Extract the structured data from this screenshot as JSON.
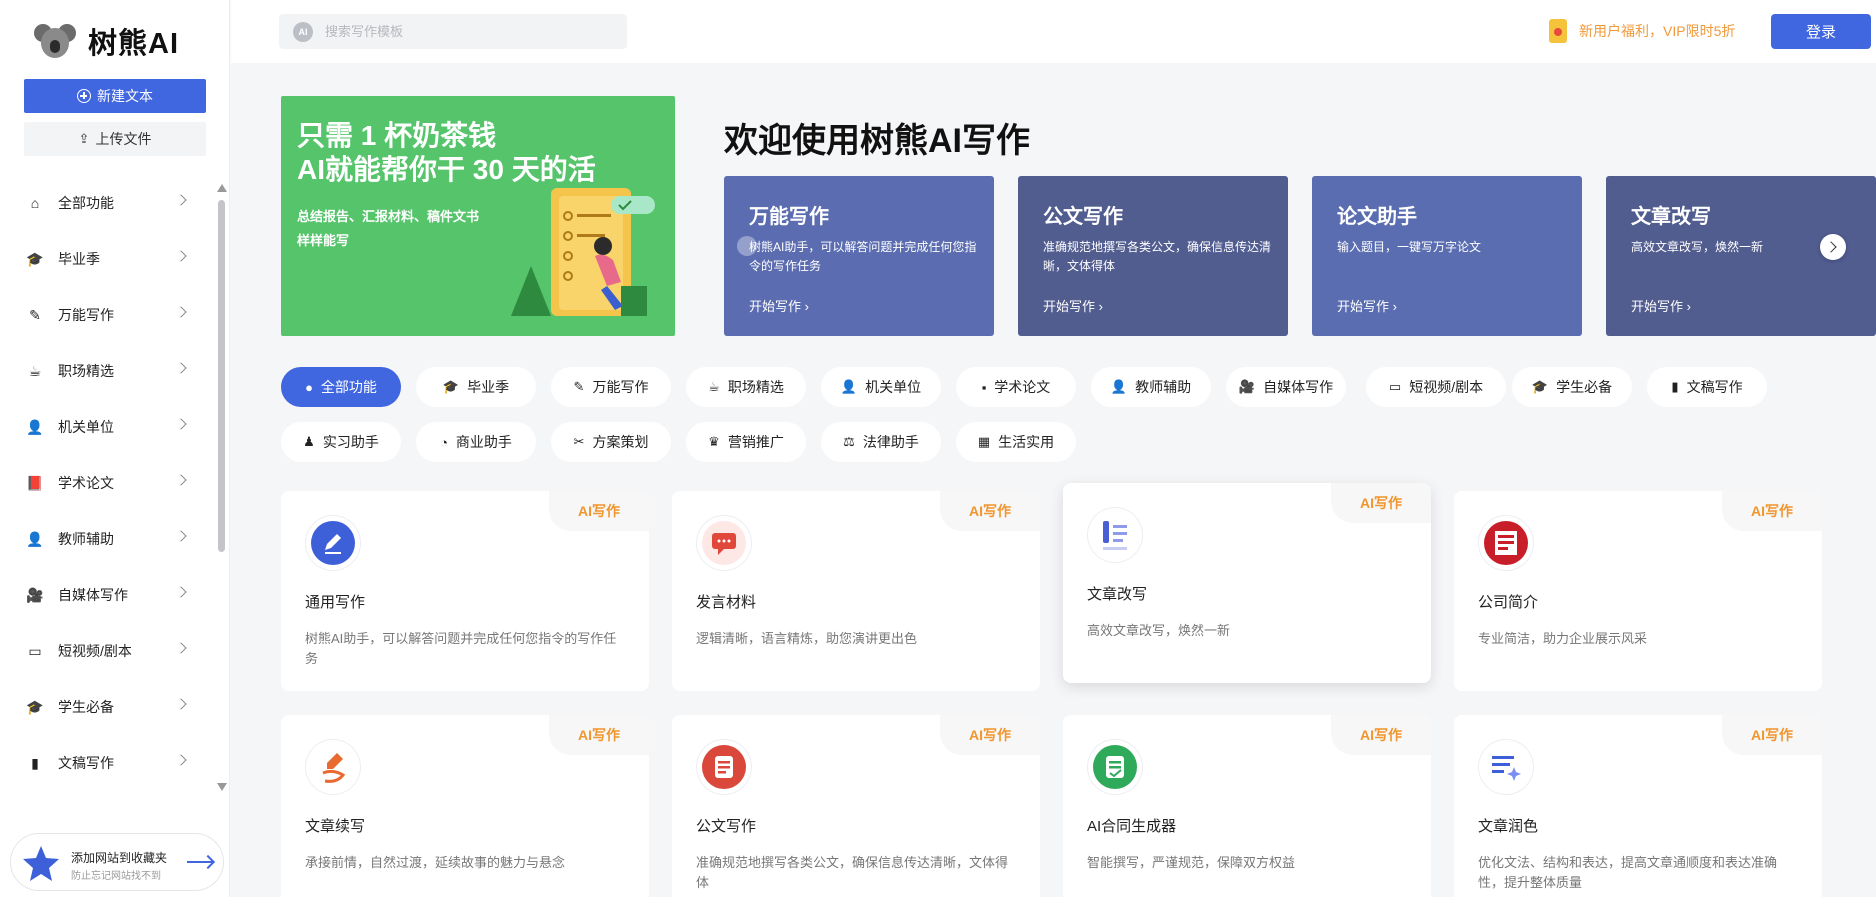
{
  "brand": {
    "name": "树熊AI"
  },
  "sidebar": {
    "new_label": "新建文本",
    "upload_label": "上传文件",
    "items": [
      {
        "label": "全部功能",
        "icon": "home-icon",
        "glyph": "⌂"
      },
      {
        "label": "毕业季",
        "icon": "grad-cap-icon",
        "glyph": "🎓"
      },
      {
        "label": "万能写作",
        "icon": "pen-icon",
        "glyph": "✎"
      },
      {
        "label": "职场精选",
        "icon": "coffee-icon",
        "glyph": "☕"
      },
      {
        "label": "机关单位",
        "icon": "person-icon",
        "glyph": "👤"
      },
      {
        "label": "学术论文",
        "icon": "book-icon",
        "glyph": "📕"
      },
      {
        "label": "教师辅助",
        "icon": "teacher-icon",
        "glyph": "👤"
      },
      {
        "label": "自媒体写作",
        "icon": "camera-icon",
        "glyph": "🎥"
      },
      {
        "label": "短视频/剧本",
        "icon": "video-icon",
        "glyph": "▭"
      },
      {
        "label": "学生必备",
        "icon": "student-cap-icon",
        "glyph": "🎓"
      },
      {
        "label": "文稿写作",
        "icon": "document-icon",
        "glyph": "▮"
      }
    ],
    "favorite": {
      "title": "添加网站到收藏夹",
      "subtitle": "防止忘记网站找不到"
    }
  },
  "topbar": {
    "search_placeholder": "搜索写作模板",
    "promo": "新用户福利，VIP限时5折",
    "login": "登录"
  },
  "banner": {
    "line1": "只需 1 杯奶茶钱",
    "line2": "AI就能帮你干 30 天的活",
    "sub1": "总结报告、汇报材料、稿件文书",
    "sub2": "样样能写"
  },
  "welcome": "欢迎使用树熊AI写作",
  "features": [
    {
      "title": "万能写作",
      "desc": "树熊AI助手，可以解答问题并完成任何您指令的写作任务",
      "start": "开始写作 ›",
      "color": "#5b6db0"
    },
    {
      "title": "公文写作",
      "desc": "准确规范地撰写各类公文，确保信息传达清晰，文体得体",
      "start": "开始写作 ›",
      "color": "#515c8f"
    },
    {
      "title": "论文助手",
      "desc": "输入题目，一键写万字论文",
      "start": "开始写作 ›",
      "color": "#5a6db1"
    },
    {
      "title": "文章改写",
      "desc": "高效文章改写，焕然一新",
      "start": "开始写作 ›",
      "color": "#515c8f"
    }
  ],
  "categories": [
    {
      "label": "全部功能",
      "glyph": "●",
      "active": true
    },
    {
      "label": "毕业季",
      "glyph": "🎓"
    },
    {
      "label": "万能写作",
      "glyph": "✎"
    },
    {
      "label": "职场精选",
      "glyph": "☕"
    },
    {
      "label": "机关单位",
      "glyph": "👤"
    },
    {
      "label": "学术论文",
      "glyph": "▪"
    },
    {
      "label": "教师辅助",
      "glyph": "👤"
    },
    {
      "label": "自媒体写作",
      "glyph": "🎥"
    },
    {
      "label": "短视频/剧本",
      "glyph": "▭"
    },
    {
      "label": "学生必备",
      "glyph": "🎓"
    },
    {
      "label": "文稿写作",
      "glyph": "▮"
    },
    {
      "label": "实习助手",
      "glyph": "♟"
    },
    {
      "label": "商业助手",
      "glyph": "◔"
    },
    {
      "label": "方案策划",
      "glyph": "✂"
    },
    {
      "label": "营销推广",
      "glyph": "♛"
    },
    {
      "label": "法律助手",
      "glyph": "⚖"
    },
    {
      "label": "生活实用",
      "glyph": "▦"
    }
  ],
  "cards": [
    {
      "tag": "AI写作",
      "name": "通用写作",
      "desc": "树熊AI助手，可以解答问题并完成任何您指令的写作任务",
      "icon": "pen-circle-icon"
    },
    {
      "tag": "AI写作",
      "name": "发言材料",
      "desc": "逻辑清晰，语言精炼，助您演讲更出色",
      "icon": "speech-bubble-icon"
    },
    {
      "tag": "AI写作",
      "name": "文章改写",
      "desc": "高效文章改写，焕然一新",
      "icon": "rewrite-list-icon"
    },
    {
      "tag": "AI写作",
      "name": "公司简介",
      "desc": "专业简洁，助力企业展示风采",
      "icon": "company-doc-icon"
    },
    {
      "tag": "AI写作",
      "name": "文章续写",
      "desc": "承接前情，自然过渡，延续故事的魅力与悬念",
      "icon": "continue-pen-icon"
    },
    {
      "tag": "AI写作",
      "name": "公文写作",
      "desc": "准确规范地撰写各类公文，确保信息传达清晰，文体得体",
      "icon": "official-doc-icon"
    },
    {
      "tag": "AI写作",
      "name": "AI合同生成器",
      "desc": "智能撰写，严谨规范，保障双方权益",
      "icon": "contract-icon"
    },
    {
      "tag": "AI写作",
      "name": "文章润色",
      "desc": "优化文法、结构和表达，提高文章通顺度和表达准确性，提升整体质量",
      "icon": "polish-sparkle-icon"
    }
  ]
}
